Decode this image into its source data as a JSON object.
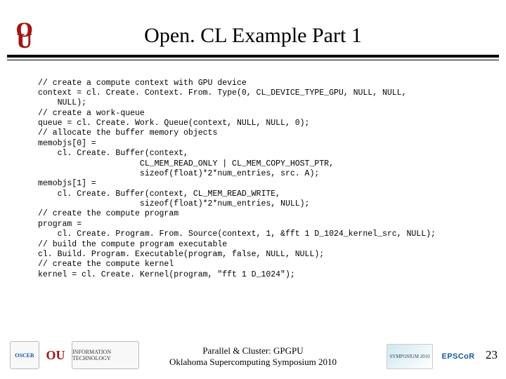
{
  "header": {
    "title": "Open. CL Example Part 1",
    "logo_alt": "OU"
  },
  "code": "// create a compute context with GPU device\ncontext = cl. Create. Context. From. Type(0, CL_DEVICE_TYPE_GPU, NULL, NULL,\n    NULL);\n// create a work-queue\nqueue = cl. Create. Work. Queue(context, NULL, NULL, 0);\n// allocate the buffer memory objects\nmemobjs[0] =\n    cl. Create. Buffer(context,\n                     CL_MEM_READ_ONLY | CL_MEM_COPY_HOST_PTR,\n                     sizeof(float)*2*num_entries, src. A);\nmemobjs[1] =\n    cl. Create. Buffer(context, CL_MEM_READ_WRITE,\n                     sizeof(float)*2*num_entries, NULL);\n// create the compute program\nprogram =\n    cl. Create. Program. From. Source(context, 1, &fft 1 D_1024_kernel_src, NULL);\n// build the compute program executable\ncl. Build. Program. Executable(program, false, NULL, NULL);\n// create the compute kernel\nkernel = cl. Create. Kernel(program, \"fft 1 D_1024\");",
  "footer": {
    "center_line1": "Parallel & Cluster: GPGPU",
    "center_line2": "Oklahoma Supercomputing Symposium 2010",
    "page_number": "23",
    "logos": {
      "oscer": "OSCER",
      "ou": "OU",
      "it": "INFORMATION TECHNOLOGY",
      "symposium": "SYMPOSIUM 2010",
      "epscor": "EPSCoR"
    }
  }
}
